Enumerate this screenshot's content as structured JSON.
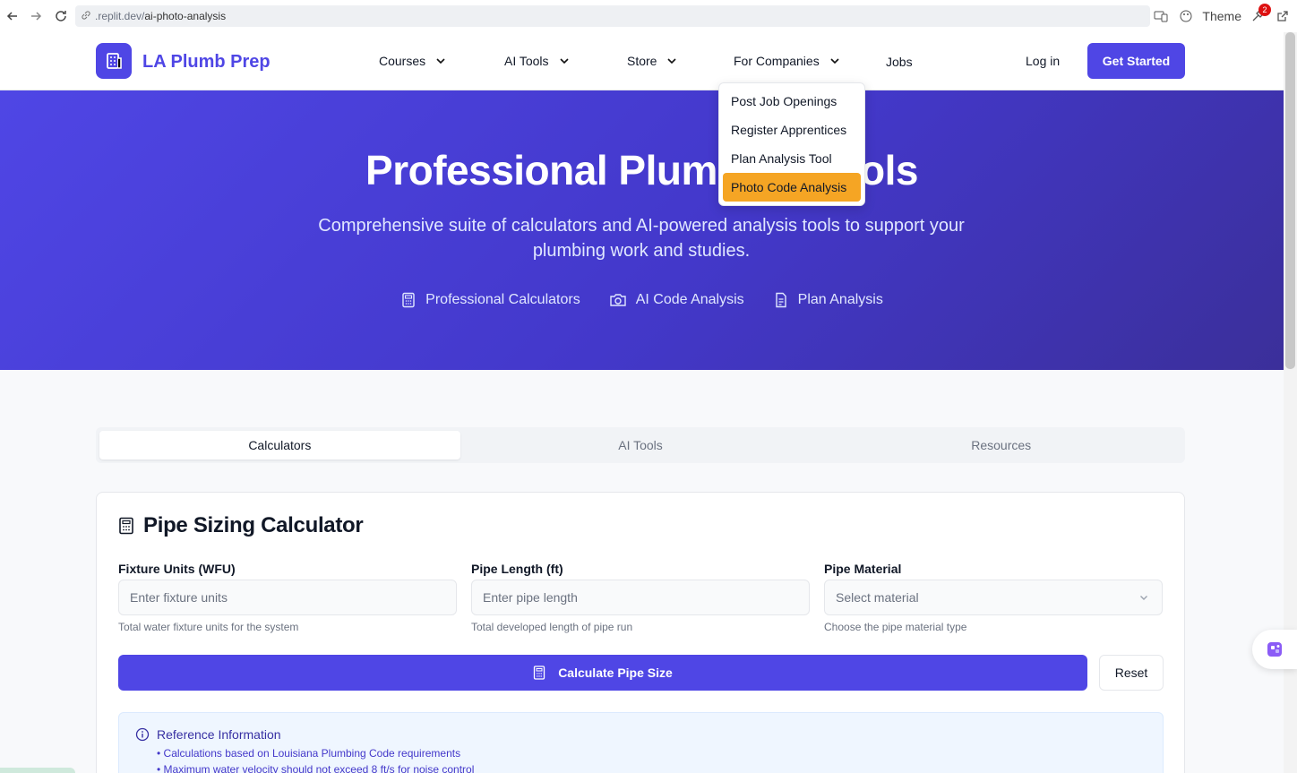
{
  "browser": {
    "url_prefix": ".replit.dev/",
    "url_path": "ai-photo-analysis",
    "theme_label": "Theme",
    "notification_count": "2"
  },
  "header": {
    "logo_text": "LA Plumb Prep",
    "nav": [
      {
        "label": "Courses"
      },
      {
        "label": "AI Tools"
      },
      {
        "label": "Store"
      },
      {
        "label": "For Companies"
      },
      {
        "label": "Jobs"
      }
    ],
    "login": "Log in",
    "cta": "Get Started"
  },
  "dropdown": {
    "items": [
      "Post Job Openings",
      "Register Apprentices",
      "Plan Analysis Tool",
      "Photo Code Analysis"
    ],
    "active_item": "Photo Code Analysis"
  },
  "hero": {
    "title": "Professional Plumbing Tools",
    "subtitle": "Comprehensive suite of calculators and AI-powered analysis tools to support your plumbing work and studies.",
    "features": [
      "Professional Calculators",
      "AI Code Analysis",
      "Plan Analysis"
    ]
  },
  "tabs": {
    "items": [
      "Calculators",
      "AI Tools",
      "Resources"
    ],
    "active": "Calculators"
  },
  "calculator": {
    "title": "Pipe Sizing Calculator",
    "fields": [
      {
        "label": "Fixture Units (WFU)",
        "placeholder": "Enter fixture units",
        "hint": "Total water fixture units for the system"
      },
      {
        "label": "Pipe Length (ft)",
        "placeholder": "Enter pipe length",
        "hint": "Total developed length of pipe run"
      },
      {
        "label": "Pipe Material",
        "placeholder": "Select material",
        "hint": "Choose the pipe material type"
      }
    ],
    "calculate_label": "Calculate Pipe Size",
    "reset_label": "Reset",
    "reference": {
      "title": "Reference Information",
      "items": [
        "• Calculations based on Louisiana Plumbing Code requirements",
        "• Maximum water velocity should not exceed 8 ft/s for noise control"
      ]
    }
  },
  "colors": {
    "primary": "#4f46e5",
    "dropdown_active": "#f5a524",
    "hero_start": "#4f46e5",
    "hero_end": "#3b2f9a"
  }
}
